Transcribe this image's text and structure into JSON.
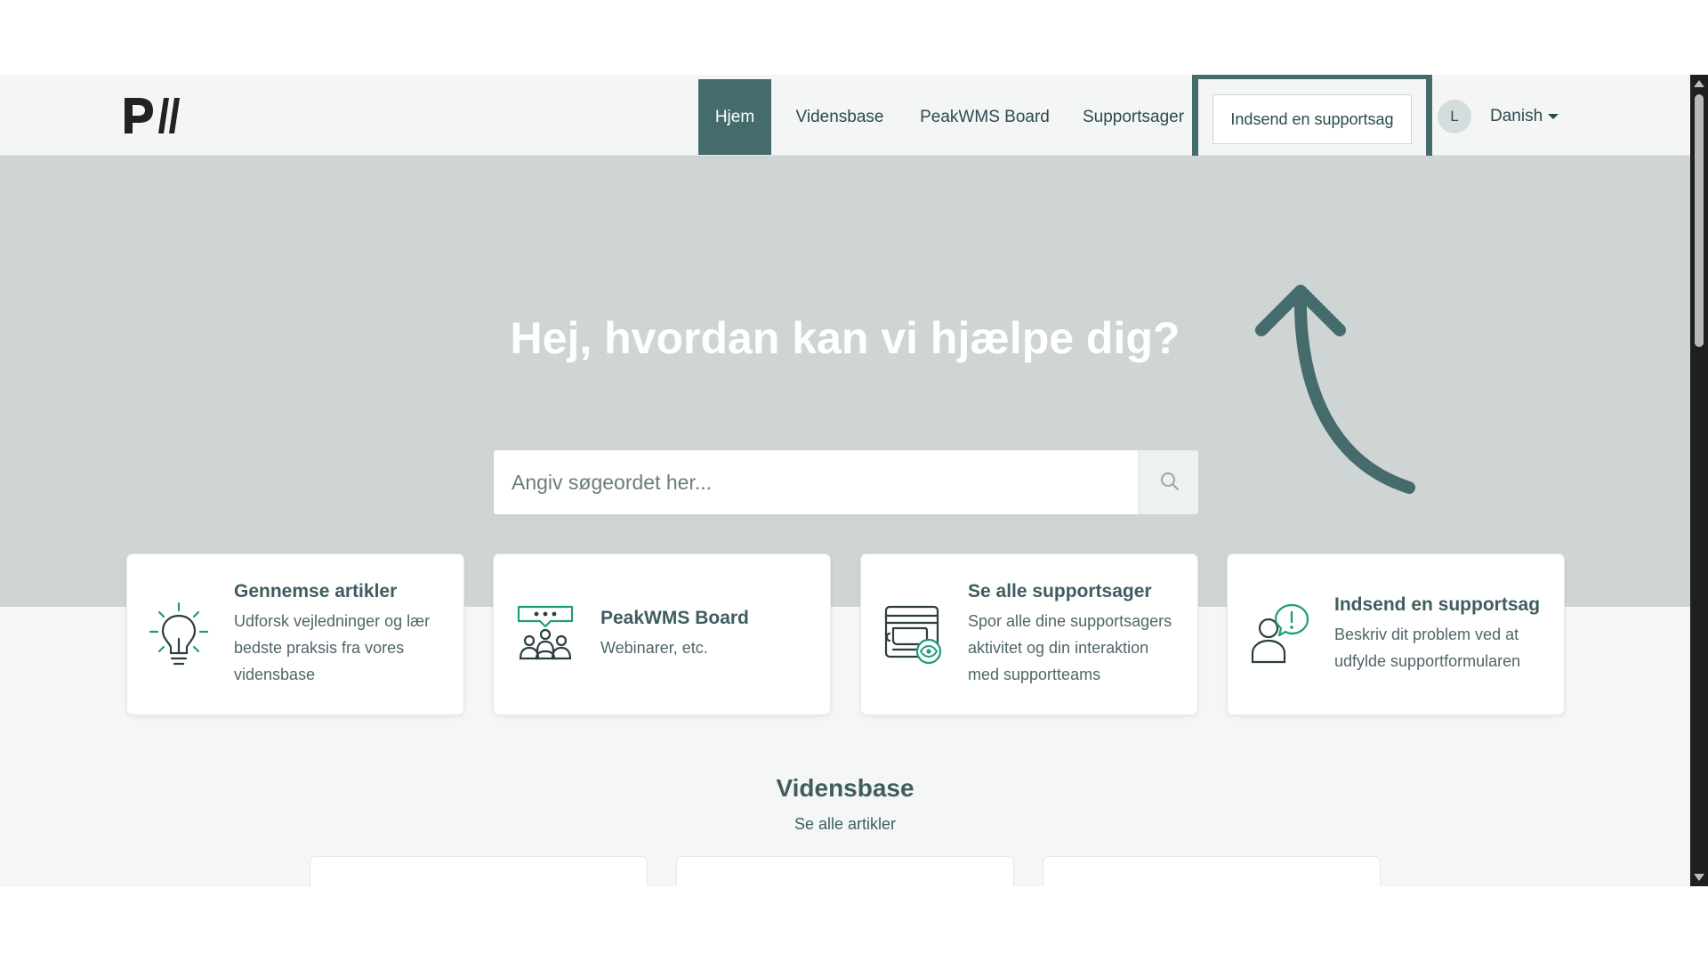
{
  "header": {
    "logo_alt": "PW",
    "nav": [
      {
        "label": "Hjem",
        "active": true
      },
      {
        "label": "Vidensbase",
        "active": false
      },
      {
        "label": "PeakWMS Board",
        "active": false
      },
      {
        "label": "Supportsager",
        "active": false
      }
    ],
    "submit_button": "Indsend en supportsag",
    "avatar_initial": "L",
    "language": "Danish"
  },
  "hero": {
    "title": "Hej, hvordan kan vi hjælpe dig?",
    "search_placeholder": "Angiv søgeordet her..."
  },
  "cards": [
    {
      "title": "Gennemse artikler",
      "description": "Udforsk vejledninger og lær bedste praksis fra vores vidensbase",
      "icon": "lightbulb-icon"
    },
    {
      "title": "PeakWMS Board",
      "description": "Webinarer, etc.",
      "icon": "community-chat-icon"
    },
    {
      "title": "Se alle supportsager",
      "description": "Spor alle dine supportsagers aktivitet og din interaktion med supportteams",
      "icon": "tickets-view-icon"
    },
    {
      "title": "Indsend en supportsag",
      "description": "Beskriv dit problem ved at udfylde supportformularen",
      "icon": "user-alert-icon"
    }
  ],
  "knowledge_base": {
    "title": "Vidensbase",
    "link": "Se alle artikler"
  },
  "colors": {
    "brand": "#456b6c",
    "accent_green": "#1e9c7c",
    "hero_bg": "#cfd5d5",
    "text": "#2c4a4d"
  }
}
